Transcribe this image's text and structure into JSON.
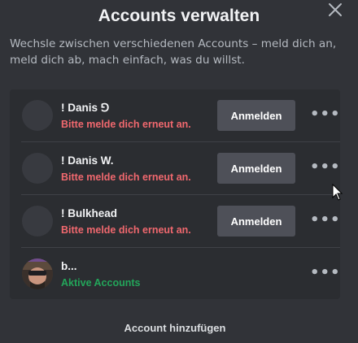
{
  "modal": {
    "title": "Accounts verwalten",
    "subtitle": "Wechsle zwischen verschiedenen Accounts – meld dich an, meld dich ab, mach einfach, was du willst.",
    "close_icon": "close-icon",
    "footer_link": "Account hinzufügen"
  },
  "accounts": [
    {
      "name": "! Danis ⅁",
      "status": "Bitte melde dich erneut an.",
      "button": "Anmelden",
      "more": "•••",
      "status_type": "error"
    },
    {
      "name": "! Danis W.",
      "status": "Bitte melde dich erneut an.",
      "button": "Anmelden",
      "more": "•••",
      "status_type": "error"
    },
    {
      "name": "! Bulkhead",
      "status": "Bitte melde dich erneut an.",
      "button": "Anmelden",
      "more": "•••",
      "status_type": "error"
    },
    {
      "name": "b...",
      "status": "Aktive Accounts",
      "more": "•••",
      "status_type": "active"
    }
  ],
  "colors": {
    "background": "#313338",
    "list_background": "#2b2d31",
    "button": "#4e5058",
    "error": "#f0686e",
    "active": "#23a55a"
  }
}
